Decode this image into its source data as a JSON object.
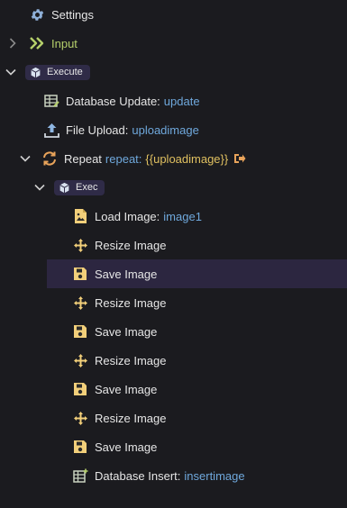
{
  "tree": {
    "settings": {
      "label": "Settings"
    },
    "input": {
      "label": "Input"
    },
    "execute": {
      "label": "Execute"
    },
    "db_update": {
      "label": "Database Update:",
      "value": "update"
    },
    "file_upload": {
      "label": "File Upload:",
      "value": "uploadimage"
    },
    "repeat": {
      "label": "Repeat",
      "keyword": "repeat:",
      "value": "{{uploadimage}}"
    },
    "exec": {
      "label": "Exec"
    },
    "load_image": {
      "label": "Load Image:",
      "value": "image1"
    },
    "steps": [
      {
        "label": "Resize Image",
        "icon": "move-icon"
      },
      {
        "label": "Save Image",
        "icon": "save-icon"
      },
      {
        "label": "Resize Image",
        "icon": "move-icon"
      },
      {
        "label": "Save Image",
        "icon": "save-icon"
      },
      {
        "label": "Resize Image",
        "icon": "move-icon"
      },
      {
        "label": "Save Image",
        "icon": "save-icon"
      },
      {
        "label": "Resize Image",
        "icon": "move-icon"
      },
      {
        "label": "Save Image",
        "icon": "save-icon"
      }
    ],
    "db_insert": {
      "label": "Database Insert:",
      "value": "insertimage"
    }
  },
  "colors": {
    "background": "#1b1b1f",
    "selected_row": "#2c2640",
    "value_blue": "#6fa8dc",
    "input_green": "#b5cf6b",
    "icon_yellow": "#f2cf7a",
    "icon_orange": "#e8a35a"
  }
}
